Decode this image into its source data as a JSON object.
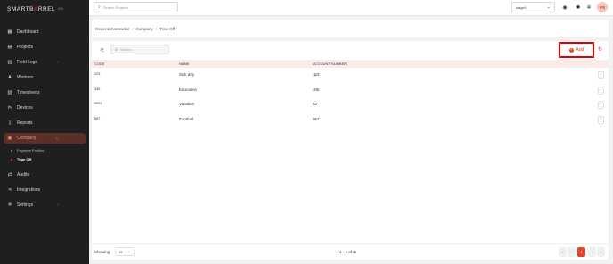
{
  "app": {
    "logo_a": "SMART",
    "logo_b": "B",
    "logo_accent": "A",
    "logo_c": "RREL",
    "version": "CN"
  },
  "topbar": {
    "search_placeholder": "Search Projects",
    "stage": "stage1",
    "avatar": "PS",
    "icons": [
      "user-circle-icon",
      "sun-icon",
      "gear-icon"
    ]
  },
  "sidebar": {
    "items": [
      {
        "label": "Dashboard",
        "icon": "dashboard-icon"
      },
      {
        "label": "Projects",
        "icon": "projects-icon"
      },
      {
        "label": "Field Logs",
        "icon": "book-icon",
        "expandable": true
      },
      {
        "label": "Workers",
        "icon": "workers-icon"
      },
      {
        "label": "Timesheets",
        "icon": "timesheet-icon"
      },
      {
        "label": "Devices",
        "icon": "devices-icon"
      },
      {
        "label": "Reports",
        "icon": "reports-icon"
      },
      {
        "label": "Company",
        "icon": "briefcase-icon",
        "active": true,
        "expandable": true
      },
      {
        "label": "Audits",
        "icon": "audit-icon"
      },
      {
        "label": "Integrations",
        "icon": "integrations-icon"
      },
      {
        "label": "Settings",
        "icon": "gear-icon",
        "expandable": true
      }
    ],
    "sub_items": [
      {
        "label": "Payment Profiles"
      },
      {
        "label": "Time Off",
        "active": true
      }
    ]
  },
  "breadcrumb": [
    "General Contractor",
    "Company",
    "Time Off"
  ],
  "toolbar": {
    "search_placeholder": "Search...",
    "add_label": "Add"
  },
  "table": {
    "columns": [
      "CODE",
      "NAME",
      "ACCOUNT NUMBER"
    ],
    "rows": [
      {
        "code": "123",
        "name": "Sick day",
        "account": "123"
      },
      {
        "code": "345",
        "name": "Education",
        "account": "345"
      },
      {
        "code": "0003",
        "name": "Vacation",
        "account": "00"
      },
      {
        "code": "567",
        "name": "Football",
        "account": "567"
      }
    ]
  },
  "footer": {
    "showing_label": "Showing:",
    "per_page": "25",
    "range_prefix": "1 - 4 of ",
    "total": "4",
    "current_page": "1"
  },
  "colors": {
    "accent": "#e0442a",
    "sidebar_bg": "#1f1f1f",
    "highlight_box": "#e00000"
  }
}
